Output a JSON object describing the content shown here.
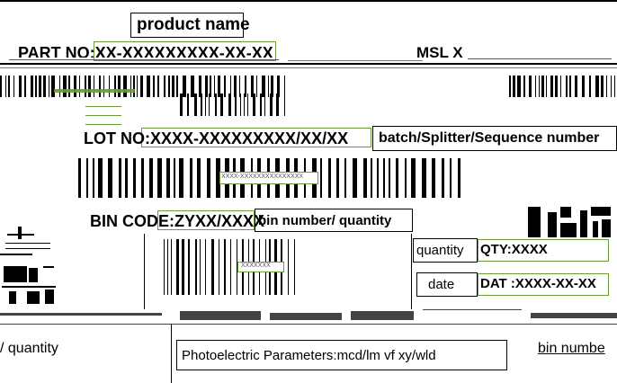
{
  "label": {
    "product_name": "product name",
    "part_no": "PART NO:XX-XXXXXXXXX-XX-XX",
    "msl": "MSL X",
    "lot_no": "LOT NO:XXXX-XXXXXXXXX/XX/XX",
    "lot_note": "batch/Splitter/Sequence number",
    "bin_code": "BIN CODE:ZYXX/XXXX",
    "bin_note": "bin number/ quantity",
    "quantity_label": "quantity",
    "quantity_value": "QTY:XXXX",
    "date_label": "date",
    "date_value": "DAT :XXXX-XX-XX",
    "bottom_left_text": "/ quantity",
    "photo_params": "Photoelectric Parameters:mcd/lm vf  xy/wld",
    "bin_number": "bin numbe",
    "barcode1_caption": "XXXX-XXXXXXXXXXXXXXX",
    "barcode2_caption": "XXXXXXX"
  },
  "colors": {
    "ink": "#000000",
    "accent": "#6a9a3a",
    "faint": "#b88a8a"
  }
}
